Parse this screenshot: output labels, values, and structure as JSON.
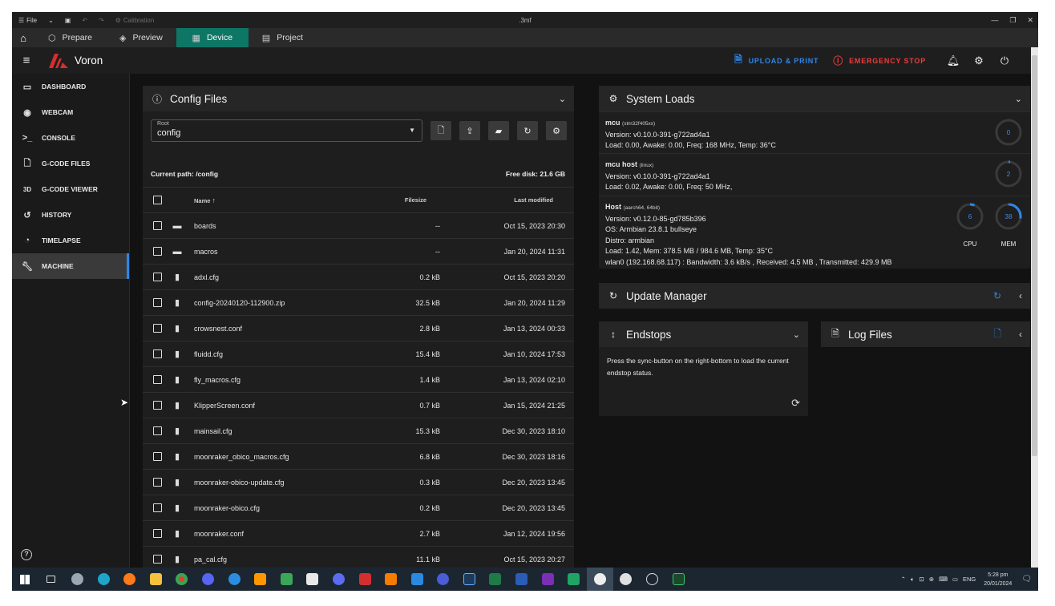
{
  "titlebar": {
    "menu_label": "File",
    "calibration": "Calibration",
    "doc_title": ".3mf"
  },
  "tabs": [
    {
      "label": "Prepare",
      "icon": "cube-outline-icon"
    },
    {
      "label": "Preview",
      "icon": "layers-icon"
    },
    {
      "label": "Device",
      "icon": "device-icon",
      "active": true
    },
    {
      "label": "Project",
      "icon": "project-icon"
    }
  ],
  "app": {
    "brand": "Voron",
    "upload_label": "UPLOAD & PRINT",
    "estop_label": "EMERGENCY STOP"
  },
  "sidebar": {
    "items": [
      {
        "label": "DASHBOARD",
        "icon": "dashboard-icon"
      },
      {
        "label": "WEBCAM",
        "icon": "webcam-icon"
      },
      {
        "label": "CONSOLE",
        "icon": "console-icon"
      },
      {
        "label": "G-CODE FILES",
        "icon": "file-icon"
      },
      {
        "label": "G-CODE VIEWER",
        "icon": "3d-icon"
      },
      {
        "label": "HISTORY",
        "icon": "history-icon"
      },
      {
        "label": "TIMELAPSE",
        "icon": "timelapse-icon"
      },
      {
        "label": "MACHINE",
        "icon": "wrench-icon",
        "active": true
      }
    ]
  },
  "config": {
    "title": "Config Files",
    "root_label": "Root",
    "root_value": "config",
    "current_path": "Current path: /config",
    "free_disk": "Free disk: 21.6 GB",
    "headers": {
      "name": "Name",
      "size": "Filesize",
      "modified": "Last modified"
    },
    "files": [
      {
        "name": "boards",
        "size": "--",
        "modified": "Oct 15, 2023 20:30",
        "type": "folder"
      },
      {
        "name": "macros",
        "size": "--",
        "modified": "Jan 20, 2024 11:31",
        "type": "folder"
      },
      {
        "name": "adxl.cfg",
        "size": "0.2 kB",
        "modified": "Oct 15, 2023 20:20",
        "type": "file"
      },
      {
        "name": "config-20240120-112900.zip",
        "size": "32.5 kB",
        "modified": "Jan 20, 2024 11:29",
        "type": "file"
      },
      {
        "name": "crowsnest.conf",
        "size": "2.8 kB",
        "modified": "Jan 13, 2024 00:33",
        "type": "file"
      },
      {
        "name": "fluidd.cfg",
        "size": "15.4 kB",
        "modified": "Jan 10, 2024 17:53",
        "type": "file"
      },
      {
        "name": "fly_macros.cfg",
        "size": "1.4 kB",
        "modified": "Jan 13, 2024 02:10",
        "type": "file"
      },
      {
        "name": "KlipperScreen.conf",
        "size": "0.7 kB",
        "modified": "Jan 15, 2024 21:25",
        "type": "file"
      },
      {
        "name": "mainsail.cfg",
        "size": "15.3 kB",
        "modified": "Dec 30, 2023 18:10",
        "type": "file"
      },
      {
        "name": "moonraker_obico_macros.cfg",
        "size": "6.8 kB",
        "modified": "Dec 30, 2023 18:16",
        "type": "file"
      },
      {
        "name": "moonraker-obico-update.cfg",
        "size": "0.3 kB",
        "modified": "Dec 20, 2023 13:45",
        "type": "file"
      },
      {
        "name": "moonraker-obico.cfg",
        "size": "0.2 kB",
        "modified": "Dec 20, 2023 13:45",
        "type": "file"
      },
      {
        "name": "moonraker.conf",
        "size": "2.7 kB",
        "modified": "Jan 12, 2024 19:56",
        "type": "file"
      },
      {
        "name": "pa_cal.cfg",
        "size": "11.1 kB",
        "modified": "Oct 15, 2023 20:27",
        "type": "file"
      }
    ]
  },
  "system": {
    "title": "System Loads",
    "mcu": {
      "name": "mcu",
      "chip": "(stm32f405xx)",
      "version": "Version: v0.10.0-391-g722ad4a1",
      "load": "Load: 0.00, Awake: 0.00, Freq: 168 MHz, Temp: 36°C",
      "gauge": "0"
    },
    "mcu_host": {
      "name": "mcu host",
      "chip": "(linux)",
      "version": "Version: v0.10.0-391-g722ad4a1",
      "load": "Load: 0.02, Awake: 0.00, Freq: 50 MHz,",
      "gauge": "2"
    },
    "host": {
      "name": "Host",
      "chip": "(aarch64, 64bit)",
      "version": "Version: v0.12.0-85-gd785b396",
      "os": "OS: Armbian 23.8.1 bullseye",
      "distro": "Distro: armbian",
      "load": "Load: 1.42, Mem: 378.5 MB / 984.6 MB, Temp: 35°C",
      "wlan": "wlan0 (192.168.68.117) : Bandwidth: 3.6 kB/s , Received: 4.5 MB , Transmitted: 429.9 MB",
      "cpu_value": "6",
      "cpu_label": "CPU",
      "mem_value": "38",
      "mem_label": "MEM"
    }
  },
  "update_manager": {
    "title": "Update Manager"
  },
  "endstops": {
    "title": "Endstops",
    "text": "Press the sync-button on the right-bottom to load the current endstop status."
  },
  "logs": {
    "title": "Log Files"
  },
  "tray": {
    "lang": "ENG",
    "time": "5:28 pm",
    "date": "20/01/2024"
  },
  "colors": {
    "accent": "#2f86e8",
    "danger": "#ef3b3b",
    "tab_active": "#0e7665"
  }
}
